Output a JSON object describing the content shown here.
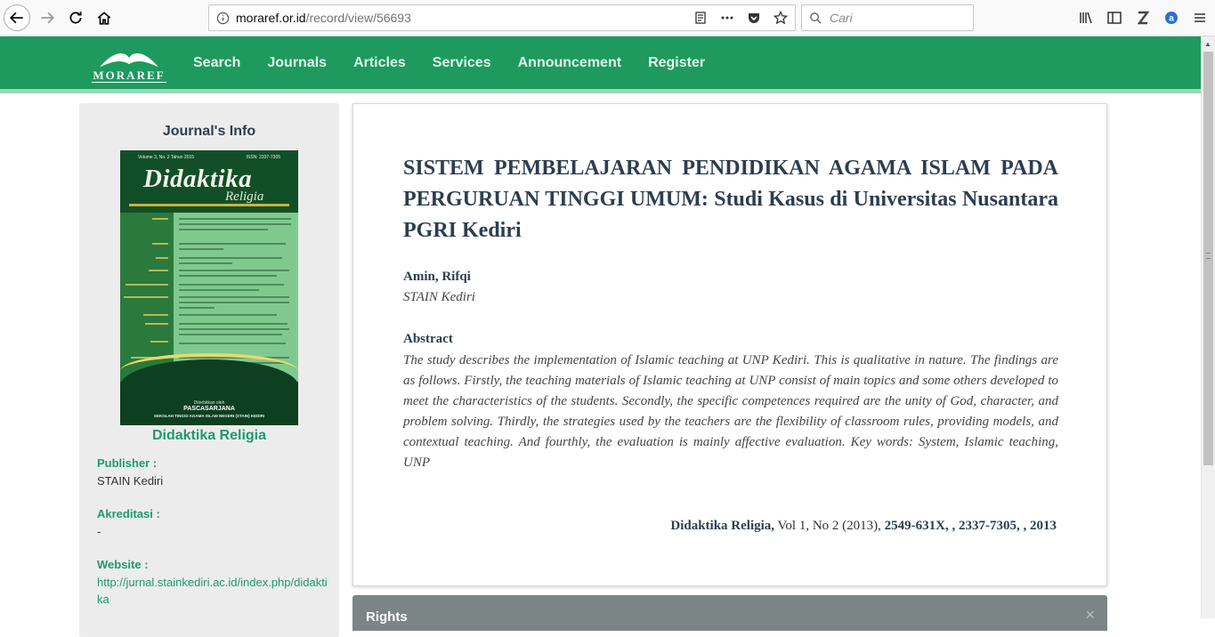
{
  "browser": {
    "url_host": "moraref.or.id",
    "url_path": "/record/view/56693",
    "search_placeholder": "Cari"
  },
  "site": {
    "logo_text": "MORAREF",
    "nav": [
      "Search",
      "Journals",
      "Articles",
      "Services",
      "Announcement",
      "Register"
    ],
    "colors": {
      "header": "#1e9a5e",
      "accent": "#1e9a6e"
    }
  },
  "sidebar": {
    "title": "Journal's Info",
    "cover": {
      "volume": "Volume 3, No. 2 Tahun 2015",
      "issn": "ISSN: 2337-7305",
      "title": "Didaktika",
      "subtitle": "Religia",
      "publisher_small": "Diterbitkan oleh",
      "publisher_program": "PASCASARJANA",
      "publisher_institution": "SEKOLAH TINGGI AGAMA ISLAM NEGERI (STAIN) KEDIRI"
    },
    "journal_name": "Didaktika Religia",
    "publisher_label": "Publisher :",
    "publisher_value": "STAIN Kediri",
    "akreditasi_label": "Akreditasi :",
    "akreditasi_value": "-",
    "website_label": "Website :",
    "website_value": "http://jurnal.stainkediri.ac.id/index.php/didaktika"
  },
  "article": {
    "title": "SISTEM PEMBELAJARAN PENDIDIKAN AGAMA ISLAM PADA PERGURUAN TINGGI UMUM: Studi Kasus di Universitas Nusantara PGRI Kediri",
    "author": "Amin, Rifqi",
    "affiliation": "STAIN Kediri",
    "abstract_heading": "Abstract",
    "abstract": "The study describes the implementation of Islamic teaching at UNP Kediri. This is qualitative in nature. The findings are as follows. Firstly, the teaching materials of Islamic teaching at UNP consist of main topics and some others developed to meet the characteristics of the students. Secondly, the specific competences required are the unity of God, character, and problem solving. Thirdly, the strategies used by the teachers are the flexibility of classroom rules, providing models, and contextual teaching. And fourthly, the evaluation is mainly affective evaluation. Key words: System, Islamic teaching, UNP",
    "citation_journal": "Didaktika Religia,",
    "citation_volume": " Vol 1, No 2 (2013), ",
    "citation_ids": "2549-631X, , 2337-7305, , 2013"
  },
  "rights": {
    "title": "Rights",
    "close": "×"
  }
}
